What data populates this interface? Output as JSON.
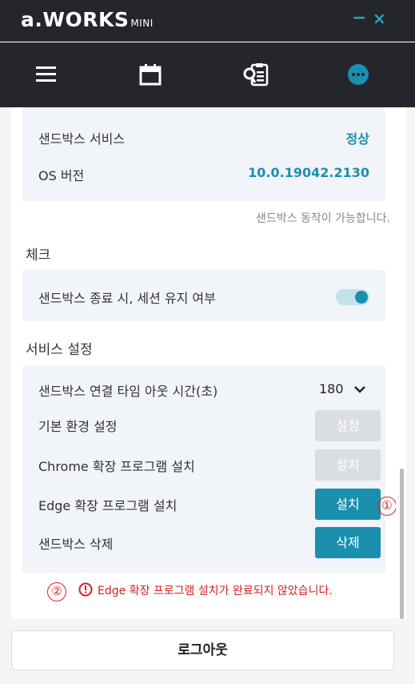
{
  "app": {
    "logo_main": "a.WORKS",
    "logo_sub": "MINI",
    "minimize_label": "−",
    "close_label": "×"
  },
  "nav": {
    "items": [
      {
        "icon": "hamburger-menu-icon"
      },
      {
        "icon": "calendar-icon"
      },
      {
        "icon": "clipboard-search-icon"
      },
      {
        "icon": "more-icon"
      }
    ],
    "active_index": 3
  },
  "sandbox_info": {
    "service_label": "샌드박스 서비스",
    "service_value": "정상",
    "os_label": "OS 버전",
    "os_value": "10.0.19042.2130",
    "note": "샌드박스 동작이 가능합니다."
  },
  "check": {
    "title": "체크",
    "session_label": "샌드박스 종료 시, 세션 유지 여부",
    "session_enabled": true
  },
  "service_settings": {
    "title": "서비스 설정",
    "timeout_label": "샌드박스 연결 타임 아웃 시간(초)",
    "timeout_value": "180",
    "basic_env_label": "기본 환경 설정",
    "basic_env_button": "설정",
    "chrome_label": "Chrome 확장 프로그램 설치",
    "chrome_button": "설치",
    "edge_label": "Edge 확장 프로그램 설치",
    "edge_button": "설치",
    "delete_label": "샌드박스 삭제",
    "delete_button": "삭제"
  },
  "annotations": {
    "marker_1": "①",
    "marker_2": "②"
  },
  "warning": {
    "text": "Edge 확장 프로그램 설치가 완료되지 않았습니다."
  },
  "logout_label": "로그아웃",
  "colors": {
    "accent": "#1a8fae",
    "header_bg": "#24262c",
    "warning": "#d42020"
  }
}
